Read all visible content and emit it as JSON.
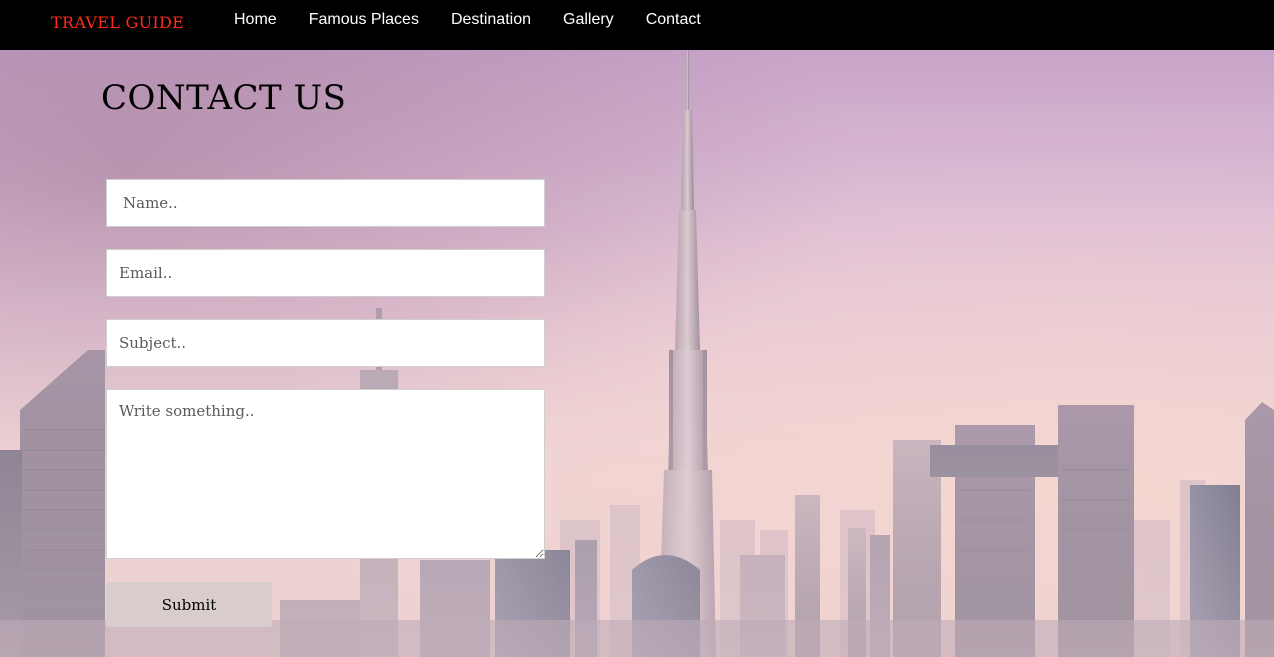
{
  "brand": "TRAVEL GUIDE",
  "nav": {
    "items": [
      {
        "label": "Home"
      },
      {
        "label": "Famous Places"
      },
      {
        "label": "Destination"
      },
      {
        "label": "Gallery"
      },
      {
        "label": "Contact"
      }
    ]
  },
  "page": {
    "title": "CONTACT US"
  },
  "form": {
    "name_placeholder": "Name..",
    "email_placeholder": "Email..",
    "subject_placeholder": "Subject..",
    "message_placeholder": "Write something..",
    "submit_label": "Submit"
  },
  "colors": {
    "navbar": "#000000",
    "brand": "#ff2a1a",
    "nav_text": "#ffffff",
    "submit_bg": "#d8cccc"
  },
  "background": {
    "icon": "city-skyline-image"
  }
}
